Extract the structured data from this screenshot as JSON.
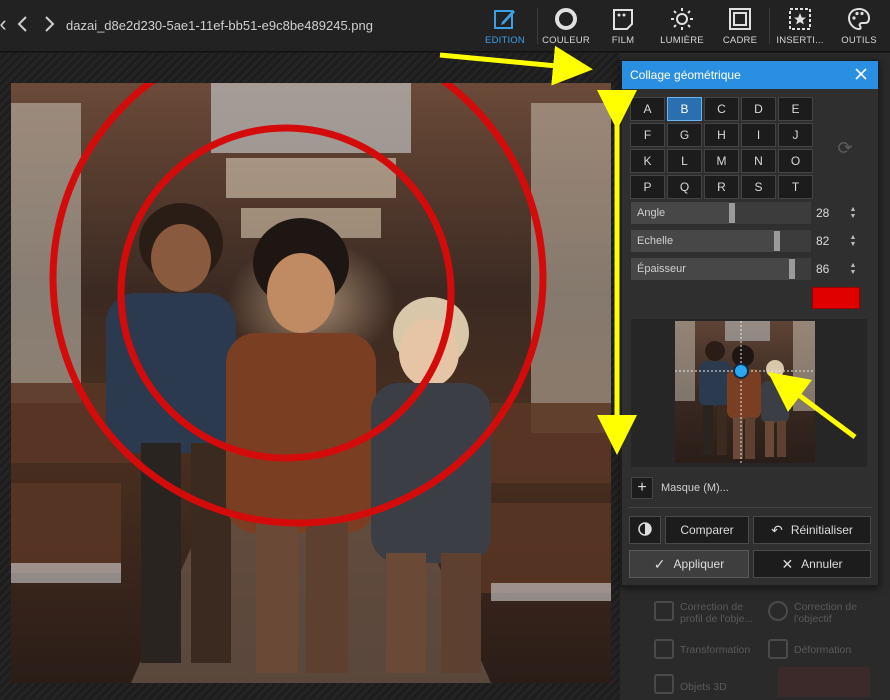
{
  "app": {
    "filename": "dazai_d8e2d230-5ae1-11ef-bb51-e9c8be489245.png",
    "nav": {
      "back_icon": "chevron-left-icon",
      "forward_icon": "chevron-right-icon",
      "prev_icon": "chevron-left-icon"
    }
  },
  "toolbar": {
    "tools": [
      {
        "label": "EDITION",
        "icon": "edit-icon",
        "active": true
      },
      {
        "label": "COULEUR",
        "icon": "circle-icon",
        "active": false
      },
      {
        "label": "FILM",
        "icon": "film-icon",
        "active": false
      },
      {
        "label": "LUMIÈRE",
        "icon": "sun-icon",
        "active": false
      },
      {
        "label": "CADRE",
        "icon": "frame-icon",
        "active": false
      },
      {
        "label": "INSERTI...",
        "icon": "insert-star-icon",
        "active": false
      },
      {
        "label": "OUTILS",
        "icon": "palette-icon",
        "active": false
      }
    ],
    "active_color": "#3aa0e8"
  },
  "background_panel": {
    "items": [
      {
        "label": "Correction de profil de l'obje...",
        "icon": "lens-profile-icon"
      },
      {
        "label": "Correction de l'objectif",
        "icon": "lens-icon"
      },
      {
        "label": "Transformation",
        "icon": "crop-icon"
      },
      {
        "label": "Déformation",
        "icon": "warp-icon"
      },
      {
        "label": "Objets 3D",
        "icon": "cube-icon"
      }
    ]
  },
  "dialog": {
    "title": "Collage géométrique",
    "header_color": "#2a8fe0",
    "letters": [
      "A",
      "B",
      "C",
      "D",
      "E",
      "F",
      "G",
      "H",
      "I",
      "J",
      "K",
      "L",
      "M",
      "N",
      "O",
      "P",
      "Q",
      "R",
      "S",
      "T"
    ],
    "selected_letter": "B",
    "sliders": [
      {
        "label": "Angle",
        "value": 28,
        "max": 100
      },
      {
        "label": "Echelle",
        "value": 82,
        "max": 100
      },
      {
        "label": "Épaisseur",
        "value": 86,
        "max": 100
      }
    ],
    "color": "#e00000",
    "mask_label": "Masque (M)...",
    "buttons": {
      "compare": "Comparer",
      "reset": "Réinitialiser",
      "apply": "Appliquer",
      "cancel": "Annuler"
    }
  },
  "annotation_color": "#ffff00",
  "circle_color": "#d40b0b"
}
